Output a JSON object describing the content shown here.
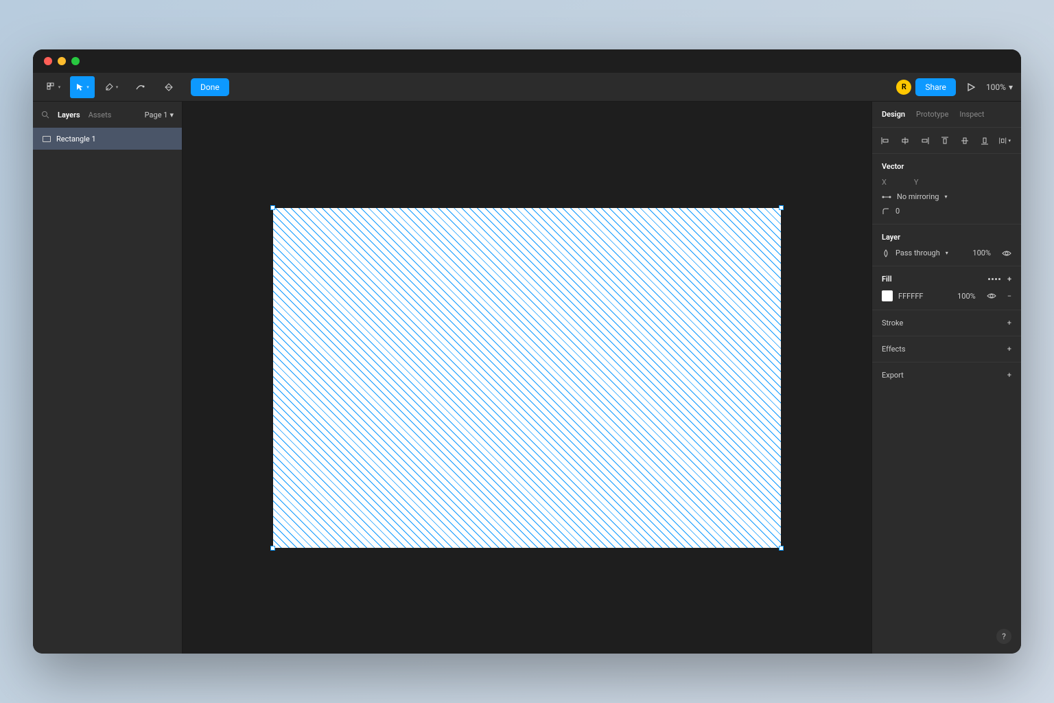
{
  "toolbar": {
    "done_label": "Done",
    "avatar_letter": "R",
    "share_label": "Share",
    "zoom": "100%"
  },
  "left_panel": {
    "tabs": {
      "layers": "Layers",
      "assets": "Assets"
    },
    "page": "Page 1",
    "layers": [
      {
        "name": "Rectangle 1"
      }
    ]
  },
  "right_panel": {
    "tabs": {
      "design": "Design",
      "prototype": "Prototype",
      "inspect": "Inspect"
    },
    "vector": {
      "title": "Vector",
      "x_label": "X",
      "y_label": "Y",
      "mirroring": "No mirroring",
      "radius": "0"
    },
    "layer": {
      "title": "Layer",
      "blend": "Pass through",
      "opacity": "100%"
    },
    "fill": {
      "title": "Fill",
      "color": "FFFFFF",
      "opacity": "100%"
    },
    "stroke": {
      "title": "Stroke"
    },
    "effects": {
      "title": "Effects"
    },
    "export": {
      "title": "Export"
    }
  },
  "help": "?"
}
